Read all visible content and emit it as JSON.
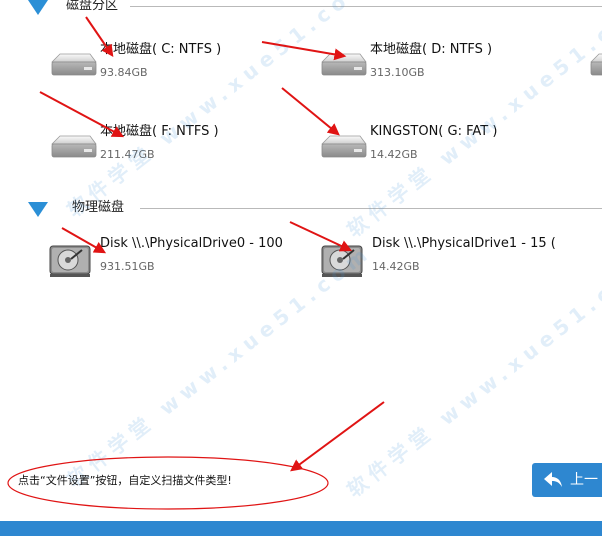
{
  "partitions": {
    "title": "磁盘分区",
    "items": [
      {
        "name": "本地磁盘( C: NTFS )",
        "size": "93.84GB"
      },
      {
        "name": "本地磁盘( D: NTFS )",
        "size": "313.10GB"
      },
      {
        "name": "本地磁盘( F: NTFS )",
        "size": "211.47GB"
      },
      {
        "name": "KINGSTON( G: FAT )",
        "size": "14.42GB"
      }
    ]
  },
  "physical": {
    "title": "物理磁盘",
    "items": [
      {
        "name": "Disk \\\\.\\PhysicalDrive0 - 100",
        "size": "931.51GB"
      },
      {
        "name": "Disk \\\\.\\PhysicalDrive1 - 15 (",
        "size": "14.42GB"
      }
    ]
  },
  "hint_text": "点击“文件设置”按钮，自定义扫描文件类型!",
  "prev_button_label": "上一",
  "watermark_text": "软件学堂 www.xue51.com",
  "colors": {
    "accent": "#2e87d0",
    "arrow": "#e01414"
  }
}
